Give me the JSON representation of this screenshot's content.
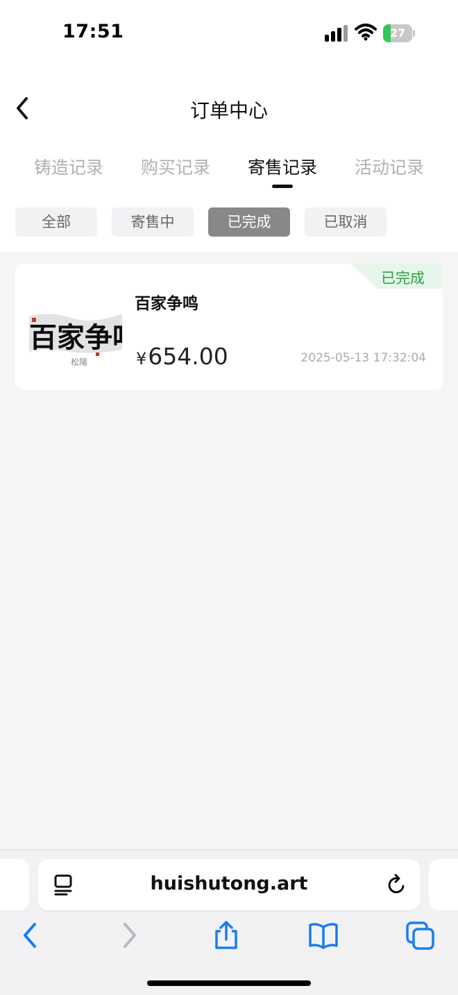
{
  "status_bar": {
    "time": "17:51",
    "battery": "27",
    "battery_level": 0.27
  },
  "header": {
    "title": "订单中心"
  },
  "tabs": [
    {
      "label": "铸造记录",
      "active": false
    },
    {
      "label": "购买记录",
      "active": false
    },
    {
      "label": "寄售记录",
      "active": true
    },
    {
      "label": "活动记录",
      "active": false
    }
  ],
  "filters": [
    {
      "label": "全部",
      "active": false
    },
    {
      "label": "寄售中",
      "active": false
    },
    {
      "label": "已完成",
      "active": true
    },
    {
      "label": "已取消",
      "active": false
    }
  ],
  "orders": [
    {
      "status": "已完成",
      "name": "百家争鸣",
      "currency": "¥",
      "price": "654.00",
      "time": "2025-05-13 17:32:04",
      "thumbnail_text": "百家争鸣"
    }
  ],
  "browser": {
    "url": "huishutong.art"
  },
  "colors": {
    "status_green": "#2ea043",
    "badge_bg": "#e6f6ea",
    "active_chip": "#888888",
    "link_blue": "#1a7cf2"
  }
}
